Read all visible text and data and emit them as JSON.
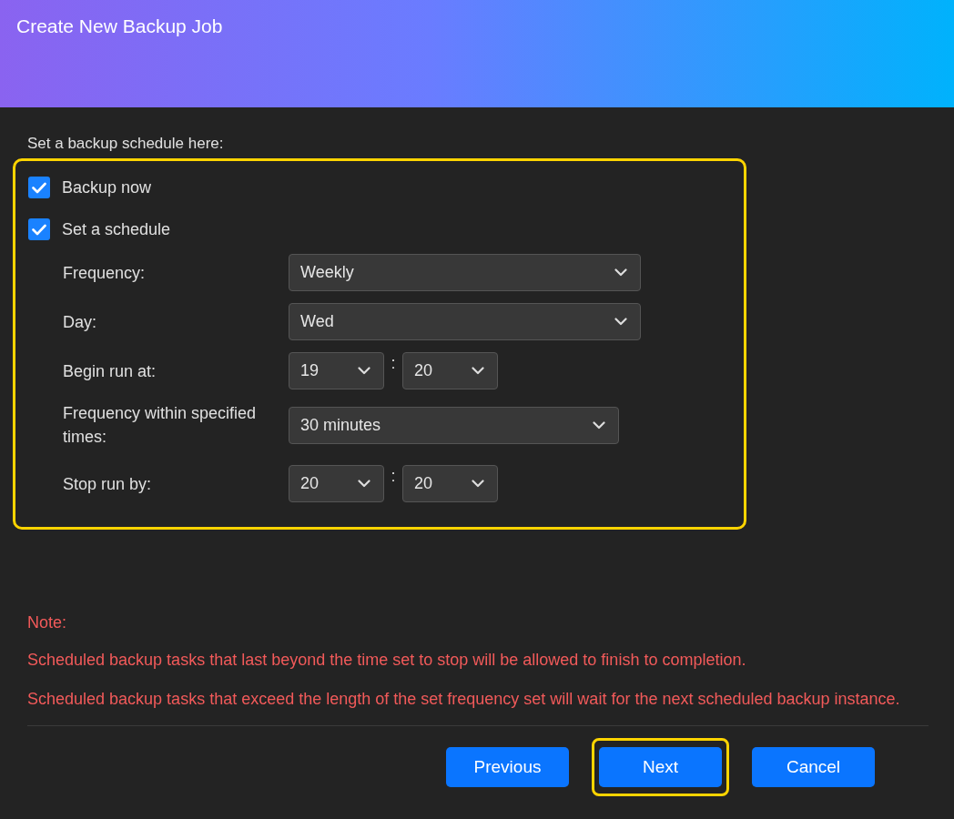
{
  "window": {
    "title": "Create New Backup Job"
  },
  "intro": "Set a backup schedule here:",
  "schedule": {
    "highlighted": true,
    "checkboxes": [
      {
        "label": "Backup now",
        "checked": true
      },
      {
        "label": "Set a schedule",
        "checked": true
      }
    ],
    "rows": [
      {
        "kind": "select",
        "label": "Frequency:",
        "value": "Weekly"
      },
      {
        "kind": "select",
        "label": "Day:",
        "value": "Wed"
      },
      {
        "kind": "time",
        "label": "Begin run at:",
        "hour": "19",
        "separator": ":",
        "minute": "20"
      },
      {
        "kind": "select-short",
        "label": "Frequency within specified times:",
        "value": "30 minutes"
      },
      {
        "kind": "time",
        "label": "Stop run by:",
        "hour": "20",
        "separator": ":",
        "minute": "20"
      }
    ]
  },
  "note": {
    "title": "Note:",
    "lines": [
      "Scheduled backup tasks that last beyond the time set to stop will be allowed to finish to completion.",
      "Scheduled backup tasks that exceed the length of the set frequency set will wait for the next scheduled backup instance."
    ]
  },
  "buttons": [
    {
      "label": "Previous",
      "highlighted": false
    },
    {
      "label": "Next",
      "highlighted": true
    },
    {
      "label": "Cancel",
      "highlighted": false
    }
  ]
}
